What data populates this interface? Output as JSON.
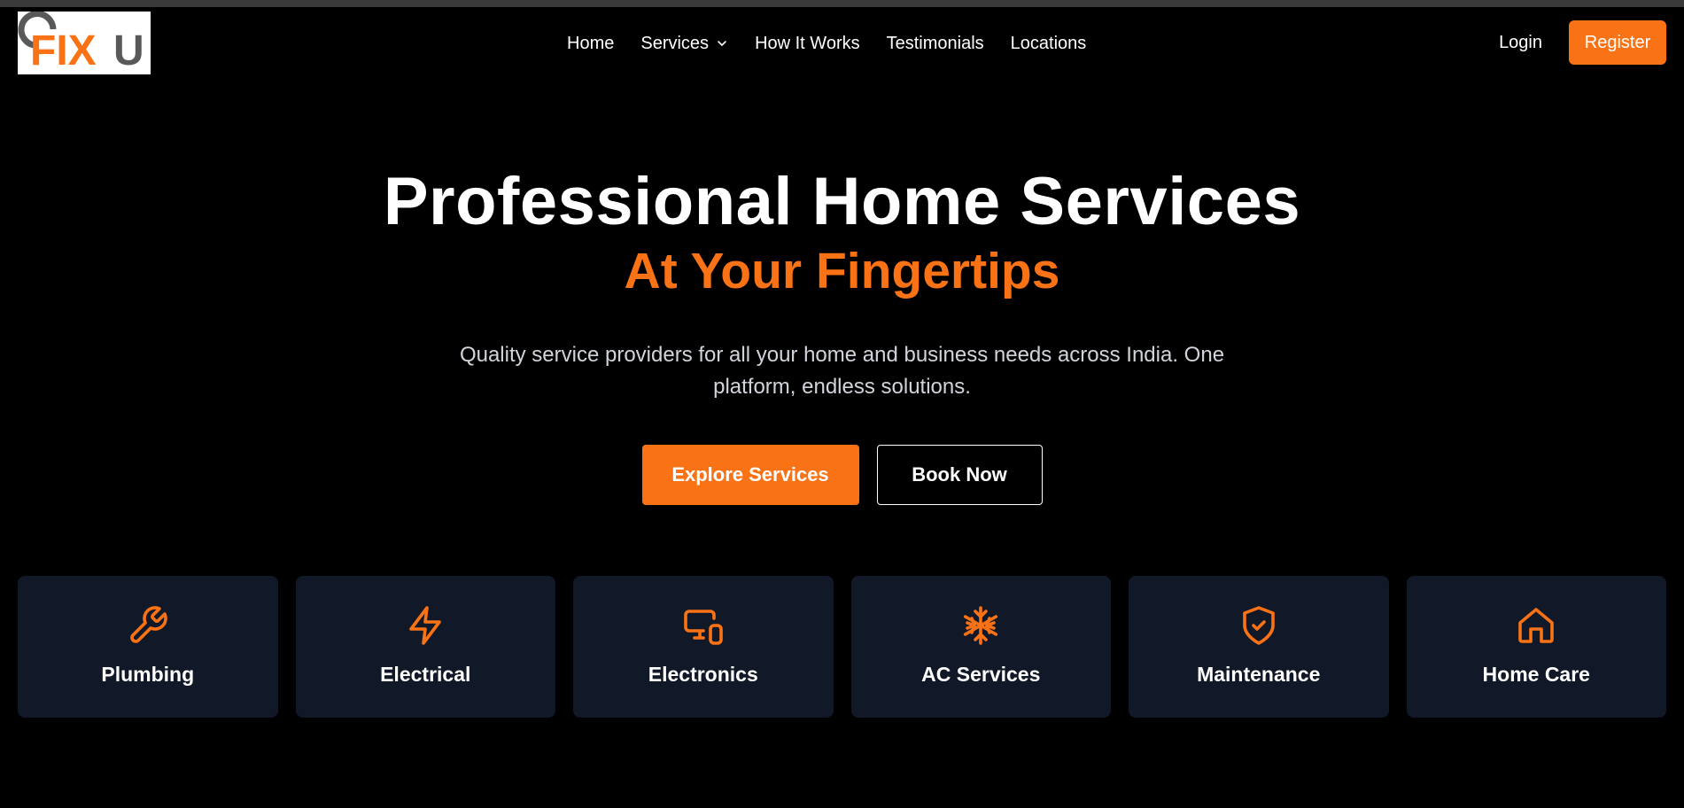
{
  "logo": {
    "text": "FIXU",
    "colors": {
      "fix": "#f97316",
      "u": "#595959",
      "arc": "#595959"
    }
  },
  "nav": {
    "items": [
      {
        "label": "Home"
      },
      {
        "label": "Services",
        "has_dropdown": true
      },
      {
        "label": "How It Works"
      },
      {
        "label": "Testimonials"
      },
      {
        "label": "Locations"
      }
    ]
  },
  "auth": {
    "login": "Login",
    "register": "Register"
  },
  "hero": {
    "title": "Professional Home Services",
    "subtitle": "At Your Fingertips",
    "description": "Quality service providers for all your home and business needs across India. One platform, endless solutions.",
    "primary_cta": "Explore Services",
    "secondary_cta": "Book Now"
  },
  "services": [
    {
      "label": "Plumbing",
      "icon": "wrench-icon"
    },
    {
      "label": "Electrical",
      "icon": "lightning-icon"
    },
    {
      "label": "Electronics",
      "icon": "devices-icon"
    },
    {
      "label": "AC Services",
      "icon": "snowflake-icon"
    },
    {
      "label": "Maintenance",
      "icon": "shield-check-icon"
    },
    {
      "label": "Home Care",
      "icon": "home-icon"
    }
  ],
  "colors": {
    "accent": "#f97316",
    "background": "#000000",
    "card": "#111827",
    "muted_text": "#d1d5db"
  }
}
